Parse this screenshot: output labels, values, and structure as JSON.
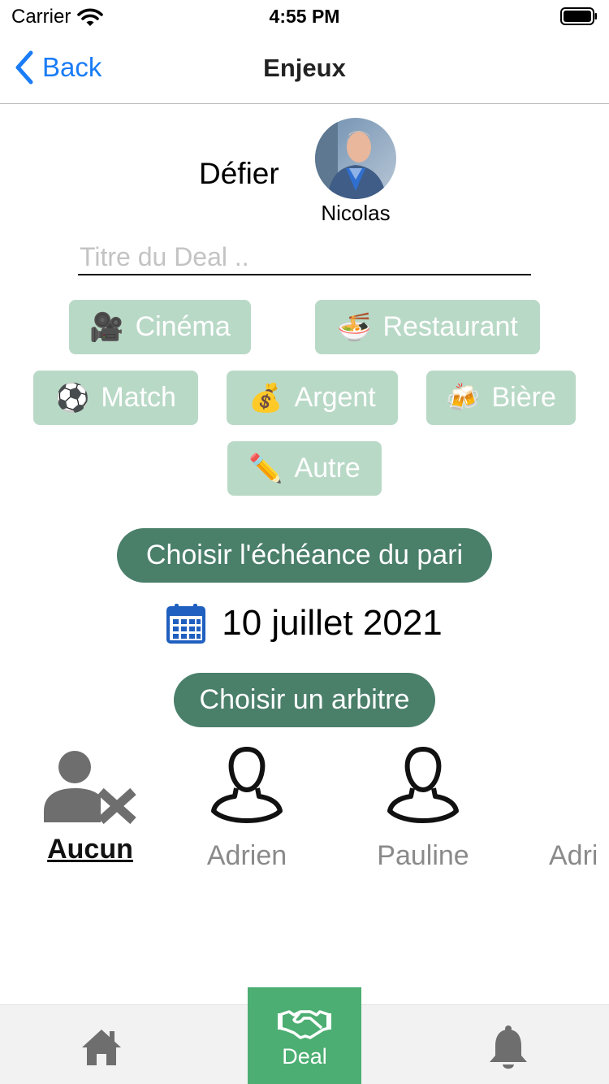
{
  "status_bar": {
    "carrier": "Carrier",
    "time": "4:55 PM"
  },
  "nav": {
    "back_label": "Back",
    "title": "Enjeux"
  },
  "challenge": {
    "label": "Défier",
    "opponent_name": "Nicolas"
  },
  "title_input": {
    "placeholder": "Titre du Deal ..",
    "value": ""
  },
  "categories": [
    {
      "emoji": "🎥",
      "label": "Cinéma"
    },
    {
      "emoji": "🍜",
      "label": "Restaurant"
    },
    {
      "emoji": "⚽",
      "label": "Match"
    },
    {
      "emoji": "💰",
      "label": "Argent"
    },
    {
      "emoji": "🍻",
      "label": "Bière"
    },
    {
      "emoji": "✏️",
      "label": "Autre"
    }
  ],
  "deadline": {
    "button_label": "Choisir l'échéance du pari",
    "date": "10 juillet 2021"
  },
  "arbiter": {
    "button_label": "Choisir un arbitre",
    "options": [
      {
        "name": "Aucun",
        "selected": true
      },
      {
        "name": "Adrien",
        "selected": false
      },
      {
        "name": "Pauline",
        "selected": false
      },
      {
        "name": "Adri",
        "selected": false
      }
    ]
  },
  "tab_bar": {
    "deal_label": "Deal",
    "active_tab": "Deal"
  },
  "colors": {
    "accent_blue": "#1a7cf6",
    "chip_bg": "#b9d9c7",
    "pill_bg": "#4a7f6a",
    "tab_active_bg": "#4cae72",
    "calendar_blue": "#1f5fbf"
  },
  "icons": [
    "wifi-icon",
    "battery-icon",
    "back-chevron-icon",
    "calendar-icon",
    "user-remove-icon",
    "user-outline-icon",
    "home-icon",
    "handshake-icon",
    "bell-icon"
  ]
}
